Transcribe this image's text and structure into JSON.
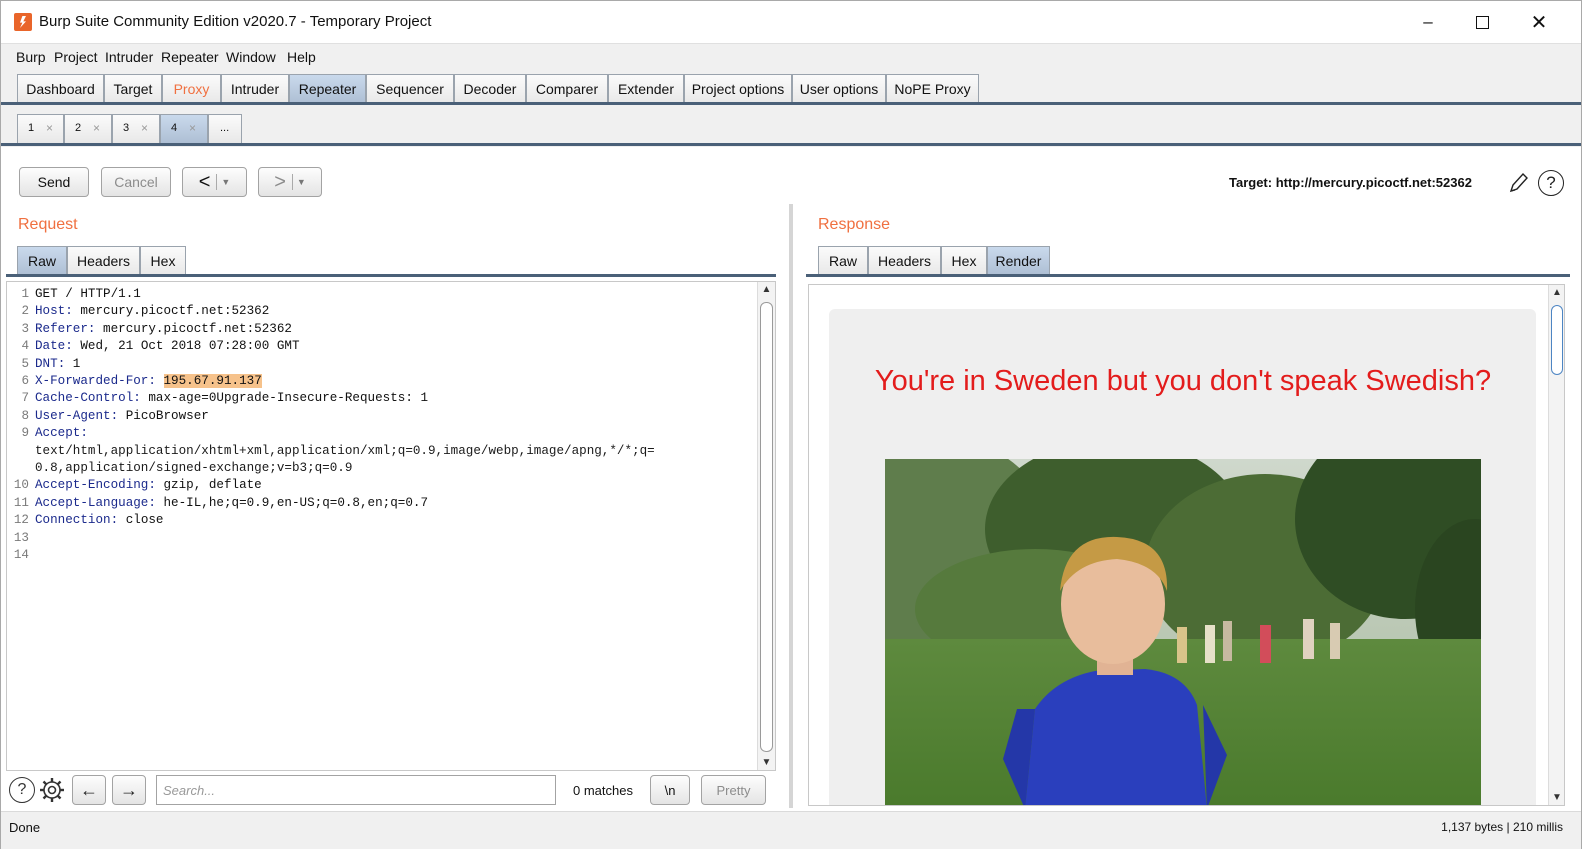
{
  "window": {
    "title": "Burp Suite Community Edition v2020.7 - Temporary Project",
    "minimize": "–",
    "close": "✕"
  },
  "menu": [
    "Burp",
    "Project",
    "Intruder",
    "Repeater",
    "Window",
    "Help"
  ],
  "main_tabs": [
    "Dashboard",
    "Target",
    "Proxy",
    "Intruder",
    "Repeater",
    "Sequencer",
    "Decoder",
    "Comparer",
    "Extender",
    "Project options",
    "User options",
    "NoPE Proxy"
  ],
  "main_tabs_active": "Repeater",
  "sub_tabs": [
    "1",
    "2",
    "3",
    "4",
    "..."
  ],
  "sub_tabs_active": "4",
  "toolbar": {
    "send": "Send",
    "cancel": "Cancel",
    "prev": "<",
    "next": ">",
    "target_label": "Target: http://mercury.picoctf.net:52362",
    "help": "?"
  },
  "request": {
    "title": "Request",
    "tabs": [
      "Raw",
      "Headers",
      "Hex"
    ],
    "active_tab": "Raw",
    "lines": [
      {
        "n": "1",
        "name": "",
        "value": "GET / HTTP/1.1"
      },
      {
        "n": "2",
        "name": "Host",
        "value": " mercury.picoctf.net:52362"
      },
      {
        "n": "3",
        "name": "Referer",
        "value": " mercury.picoctf.net:52362"
      },
      {
        "n": "4",
        "name": "Date",
        "value": " Wed, 21 Oct 2018 07:28:00 GMT"
      },
      {
        "n": "5",
        "name": "DNT",
        "value": " 1"
      },
      {
        "n": "6",
        "name": "X-Forwarded-For",
        "value": "195.67.91.137"
      },
      {
        "n": "7",
        "name": "Cache-Control",
        "value": " max-age=0Upgrade-Insecure-Requests: 1"
      },
      {
        "n": "8",
        "name": "User-Agent",
        "value": " PicoBrowser"
      },
      {
        "n": "9",
        "name": "Accept",
        "value": ""
      },
      {
        "n": "",
        "name": "",
        "value": "text/html,application/xhtml+xml,application/xml;q=0.9,image/webp,image/apng,*/*;q="
      },
      {
        "n": "",
        "name": "",
        "value": "0.8,application/signed-exchange;v=b3;q=0.9"
      },
      {
        "n": "10",
        "name": "Accept-Encoding",
        "value": " gzip, deflate"
      },
      {
        "n": "11",
        "name": "Accept-Language",
        "value": " he-IL,he;q=0.9,en-US;q=0.8,en;q=0.7"
      },
      {
        "n": "12",
        "name": "Connection",
        "value": " close"
      },
      {
        "n": "13",
        "name": "",
        "value": ""
      },
      {
        "n": "14",
        "name": "",
        "value": ""
      }
    ]
  },
  "search": {
    "placeholder": "Search...",
    "matches": "0 matches",
    "newline_btn": "\\n",
    "pretty_btn": "Pretty",
    "prev": "←",
    "next": "→",
    "help": "?"
  },
  "response": {
    "title": "Response",
    "tabs": [
      "Raw",
      "Headers",
      "Hex",
      "Render"
    ],
    "active_tab": "Render",
    "heading": "You're in Sweden but you don't speak Swedish?"
  },
  "status": {
    "left": "Done",
    "right": "1,137 bytes | 210 millis"
  },
  "colors": {
    "accent_orange": "#f07040",
    "tab_line": "#4a6078",
    "active_tab": "#b9cbe0",
    "heading_red": "#e31c1c",
    "highlight": "#f6c28b",
    "header_name": "#1b2a8c"
  },
  "icons": {
    "logo": "burp-logo-icon",
    "pencil": "pencil-icon",
    "help": "help-circle-icon",
    "settings": "gear-icon",
    "photo": "boy-in-field-photo"
  }
}
